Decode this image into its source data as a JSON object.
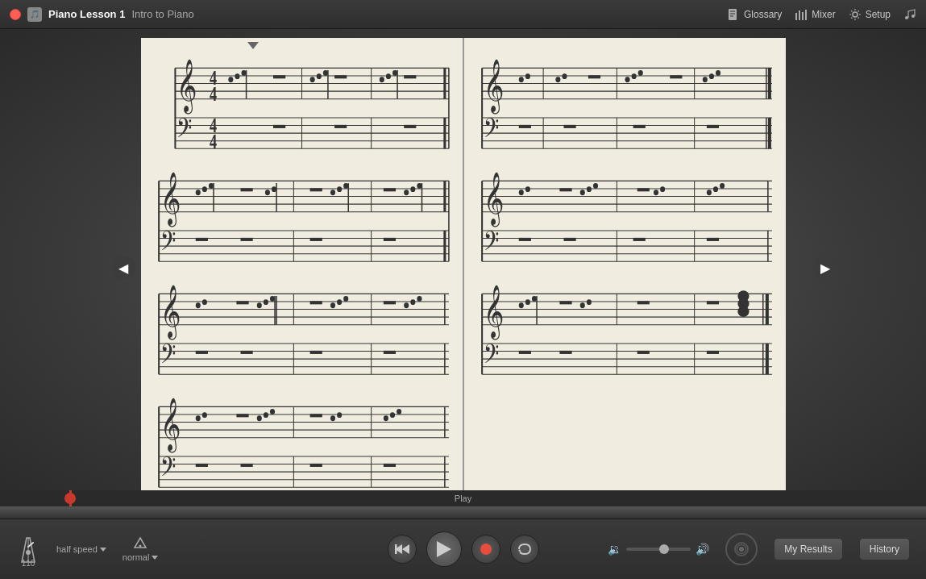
{
  "titlebar": {
    "app_name": "Piano Lesson 1",
    "subtitle": "Intro to Piano",
    "glossary_label": "Glossary",
    "mixer_label": "Mixer",
    "setup_label": "Setup"
  },
  "main": {
    "left_arrow": "◀",
    "right_arrow": "▶"
  },
  "playbar": {
    "label": "Play"
  },
  "controls": {
    "bpm": "110",
    "speed_label": "half speed",
    "normal_label": "normal",
    "rewind_label": "⏮",
    "play_label": "▶",
    "record_label": "⏺",
    "repeat_label": "↺",
    "my_results_label": "My Results",
    "history_label": "History"
  }
}
